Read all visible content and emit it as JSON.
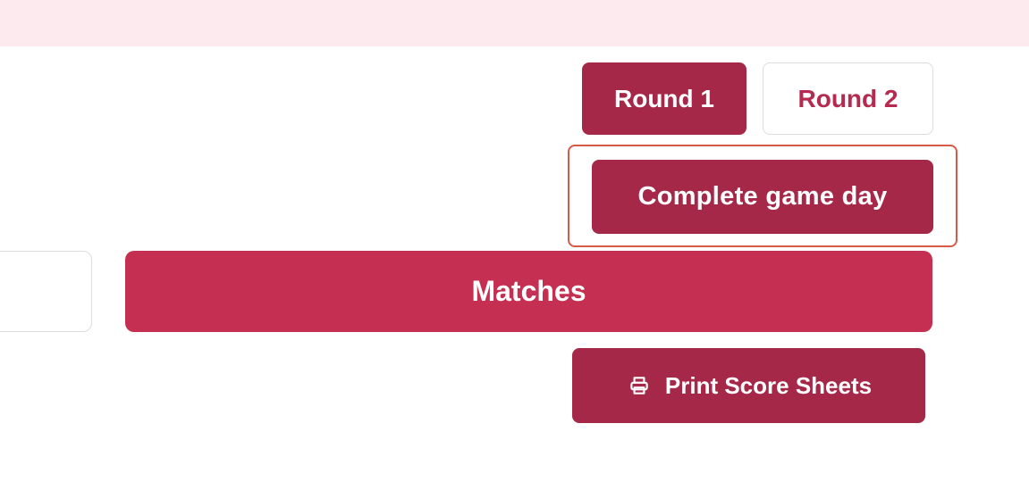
{
  "rounds": {
    "round_1_label": "Round 1",
    "round_2_label": "Round 2",
    "selected": "Round 1"
  },
  "actions": {
    "complete_game_day_label": "Complete game day",
    "matches_label": "Matches",
    "print_score_sheets_label": "Print Score Sheets",
    "print_icon": "printer-icon"
  },
  "colors": {
    "banner": "#fdeaee",
    "primary_dark": "#a52848",
    "primary": "#c52f52",
    "highlight_outline": "#d65a45"
  }
}
